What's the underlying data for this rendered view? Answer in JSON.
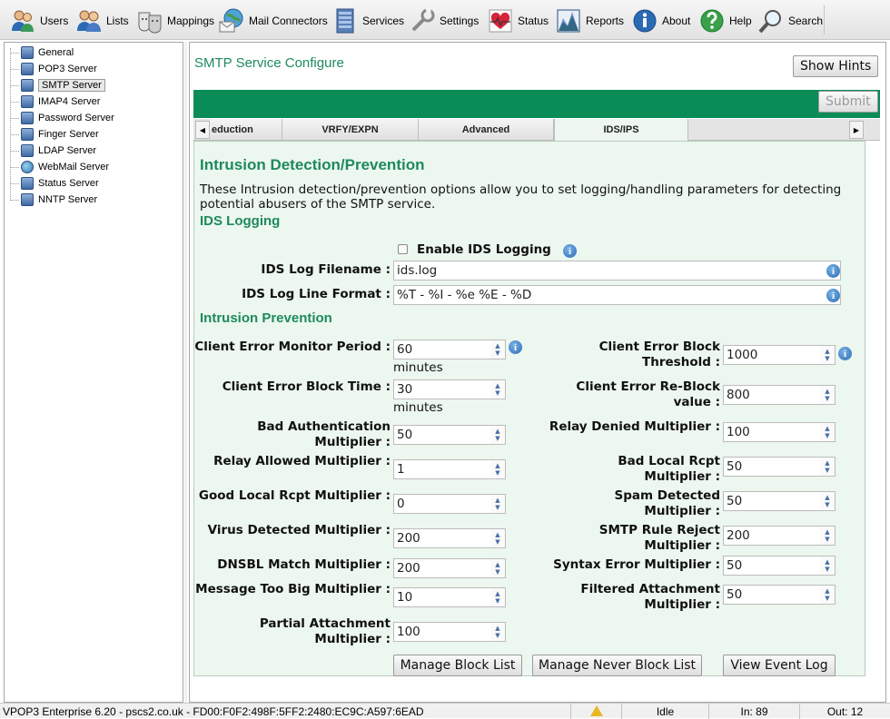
{
  "toolbar": {
    "items": [
      {
        "label": "Users",
        "icon": "users-icon"
      },
      {
        "label": "Lists",
        "icon": "lists-icon"
      },
      {
        "label": "Mappings",
        "icon": "mappings-icon"
      },
      {
        "label": "Mail Connectors",
        "icon": "mail-connectors-icon"
      },
      {
        "label": "Services",
        "icon": "services-icon"
      },
      {
        "label": "Settings",
        "icon": "settings-icon"
      },
      {
        "label": "Status",
        "icon": "status-icon"
      },
      {
        "label": "Reports",
        "icon": "reports-icon"
      },
      {
        "label": "About",
        "icon": "about-icon"
      },
      {
        "label": "Help",
        "icon": "help-icon"
      },
      {
        "label": "Search",
        "icon": "search-icon"
      }
    ]
  },
  "sidebar": {
    "items": [
      {
        "label": "General"
      },
      {
        "label": "POP3 Server"
      },
      {
        "label": "SMTP Server",
        "selected": true
      },
      {
        "label": "IMAP4 Server"
      },
      {
        "label": "Password Server"
      },
      {
        "label": "Finger Server"
      },
      {
        "label": "LDAP Server"
      },
      {
        "label": "WebMail Server"
      },
      {
        "label": "Status Server"
      },
      {
        "label": "NNTP Server"
      }
    ]
  },
  "main": {
    "title": "SMTP Service Configure",
    "show_hints_label": "Show Hints",
    "submit_label": "Submit",
    "tabs": [
      {
        "label": "eduction"
      },
      {
        "label": "VRFY/EXPN"
      },
      {
        "label": "Advanced"
      },
      {
        "label": "IDS/IPS",
        "active": true
      }
    ],
    "scroll_left": "◀",
    "scroll_right": "▶"
  },
  "panel": {
    "title": "Intrusion Detection/Prevention",
    "description": "These Intrusion detection/prevention options allow you to set logging/handling parameters for detecting potential abusers of the SMTP service.",
    "ids_logging_heading": "IDS Logging",
    "enable_ids_logging": {
      "label": "Enable IDS Logging",
      "checked": false
    },
    "log_filename": {
      "label": "IDS Log Filename :",
      "value": "ids.log"
    },
    "log_line_format": {
      "label": "IDS Log Line Format :",
      "value": "%T - %I - %e %E - %D"
    },
    "intrusion_prevention_heading": "Intrusion Prevention",
    "minutes_unit": "minutes",
    "fields": {
      "client_error_monitor_period": {
        "label": "Client Error Monitor Period :",
        "value": "60"
      },
      "client_error_block_threshold": {
        "label": "Client Error Block Threshold :",
        "value": "1000"
      },
      "client_error_block_time": {
        "label": "Client Error Block Time :",
        "value": "30"
      },
      "client_error_reblock_value": {
        "label": "Client Error Re-Block value :",
        "value": "800"
      },
      "bad_authentication_multiplier": {
        "label": "Bad Authentication Multiplier :",
        "value": "50"
      },
      "relay_denied_multiplier": {
        "label": "Relay Denied Multiplier :",
        "value": "100"
      },
      "relay_allowed_multiplier": {
        "label": "Relay Allowed Multiplier :",
        "value": "1"
      },
      "bad_local_rcpt_multiplier": {
        "label": "Bad Local Rcpt Multiplier :",
        "value": "50"
      },
      "good_local_rcpt_multiplier": {
        "label": "Good Local Rcpt Multiplier :",
        "value": "0"
      },
      "spam_detected_multiplier": {
        "label": "Spam Detected Multiplier :",
        "value": "50"
      },
      "virus_detected_multiplier": {
        "label": "Virus Detected Multiplier :",
        "value": "200"
      },
      "smtp_rule_reject_multiplier": {
        "label": "SMTP Rule Reject Multiplier :",
        "value": "200"
      },
      "dnsbl_match_multiplier": {
        "label": "DNSBL Match Multiplier :",
        "value": "200"
      },
      "syntax_error_multiplier": {
        "label": "Syntax Error Multiplier :",
        "value": "50"
      },
      "message_too_big_multiplier": {
        "label": "Message Too Big Multiplier :",
        "value": "10"
      },
      "filtered_attachment_multiplier": {
        "label": "Filtered Attachment Multiplier :",
        "value": "50"
      },
      "partial_attachment_multiplier": {
        "label": "Partial Attachment Multiplier :",
        "value": "100"
      }
    },
    "buttons": {
      "manage_block_list": "Manage Block List",
      "manage_never_block_list": "Manage Never Block List",
      "view_event_log": "View Event Log"
    }
  },
  "statusbar": {
    "app_info": "VPOP3 Enterprise 6.20 - pscs2.co.uk - FD00:F0F2:498F:5FF2:2480:EC9C:A597:6EAD",
    "warning_icon": "warning-icon",
    "state": "Idle",
    "in_count": "In: 89",
    "out_count": "Out: 12"
  }
}
